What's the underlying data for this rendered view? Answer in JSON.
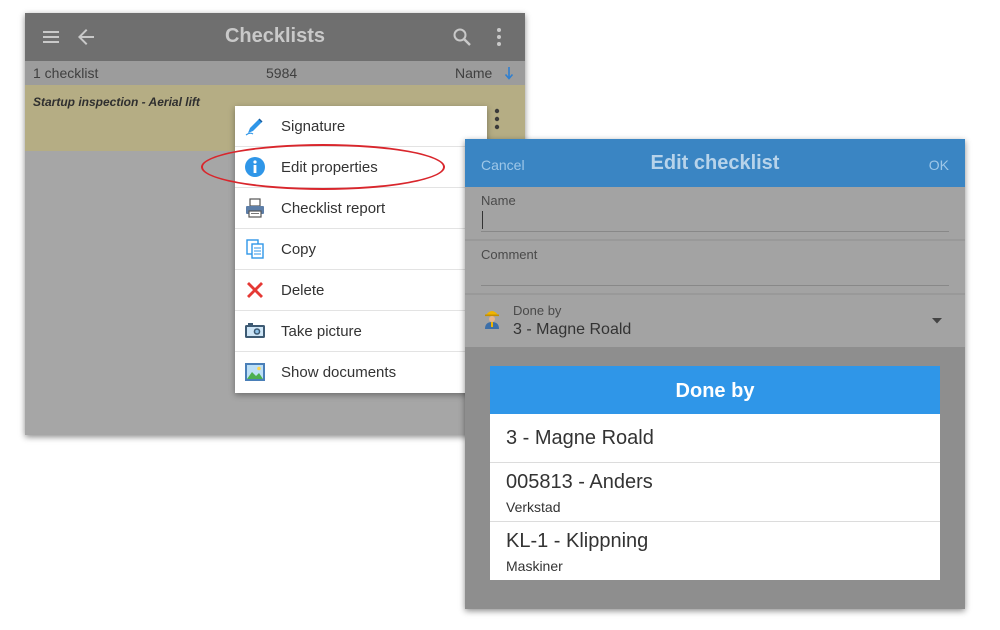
{
  "checklists_screen": {
    "title": "Checklists",
    "menu_icon": "hamburger-menu-icon",
    "back_icon": "back-arrow-icon",
    "search_icon": "search-icon",
    "overflow_icon": "more-vert-icon",
    "subbar": {
      "count": "1 checklist",
      "number": "5984",
      "sort_label": "Name",
      "sort_icon": "sort-arrow-down-icon"
    },
    "item": {
      "label": "Startup inspection - Aerial lift"
    }
  },
  "context_menu": {
    "items": [
      {
        "label": "Signature",
        "icon": "pen-icon"
      },
      {
        "label": "Edit properties",
        "icon": "info-icon"
      },
      {
        "label": "Checklist report",
        "icon": "printer-icon"
      },
      {
        "label": "Copy",
        "icon": "copy-icon"
      },
      {
        "label": "Delete",
        "icon": "delete-x-icon"
      },
      {
        "label": "Take picture",
        "icon": "camera-icon"
      },
      {
        "label": "Show documents",
        "icon": "image-icon"
      }
    ],
    "highlight_color": "#d9262c"
  },
  "edit_checklist": {
    "cancel_label": "Cancel",
    "title": "Edit checklist",
    "ok_label": "OK",
    "name_label": "Name",
    "name_value": "",
    "comment_label": "Comment",
    "comment_value": "",
    "done_by_label": "Done by",
    "done_by_value": "3 - Magne Roald"
  },
  "done_by_picker": {
    "title": "Done by",
    "options": [
      {
        "title": "3 - Magne Roald",
        "subtitle": ""
      },
      {
        "title": "005813 - Anders",
        "subtitle": "Verkstad"
      },
      {
        "title": "KL-1 - Klippning",
        "subtitle": "Maskiner"
      }
    ]
  },
  "colors": {
    "edit_header": "#3a85c3",
    "picker_header": "#2f96e8",
    "selected_row": "#b5ad84"
  }
}
